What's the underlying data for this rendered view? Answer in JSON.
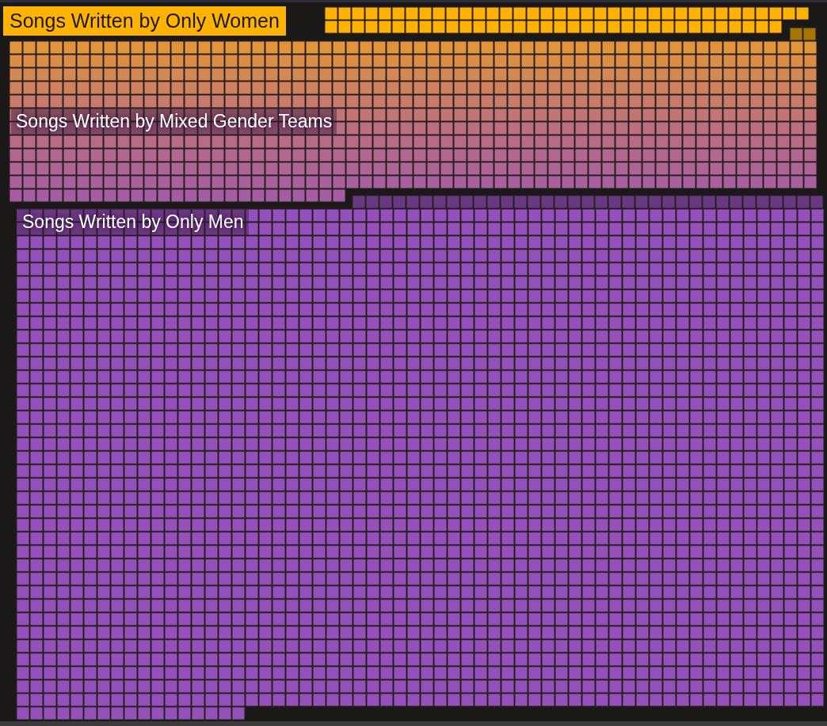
{
  "groups": [
    {
      "label": "Songs Written by Only Women",
      "kind": "boxed",
      "color": "#ffb300"
    },
    {
      "label": "Songs Written by Mixed Gender Teams",
      "kind": "floating",
      "color": "#bc6f80"
    },
    {
      "label": "Songs Written by Only Men",
      "kind": "floating",
      "color": "#9450bb"
    }
  ]
}
